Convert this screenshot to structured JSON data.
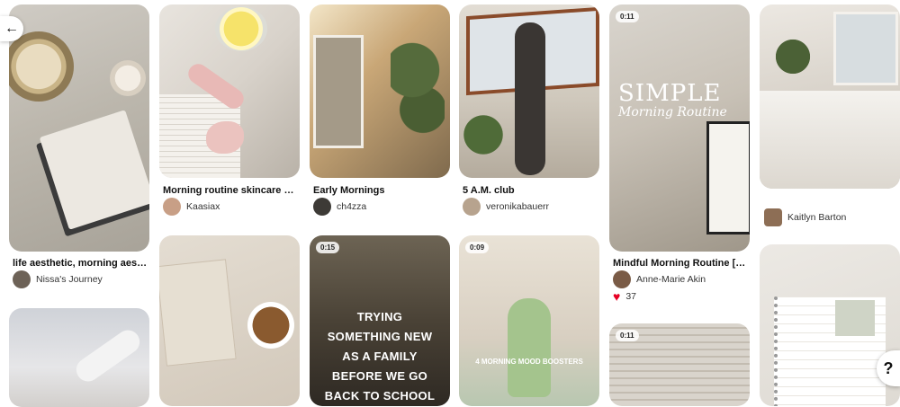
{
  "nav": {
    "back_icon": "←",
    "help_icon": "?"
  },
  "pins": [
    {
      "title": "life aesthetic, morning aesthetic",
      "author": "Nissa's Journey"
    },
    {
      "title": "Morning routine skincare mornin...",
      "author": "Kaasiax"
    },
    {
      "title": "Early Mornings",
      "author": "ch4zza"
    },
    {
      "title": "5 A.M. club",
      "author": "veronikabauerr"
    },
    {
      "title": "Mindful Morning Routine [That...",
      "author": "Anne-Marie Akin",
      "reactions": "37",
      "badge": "0:11",
      "overlay_line1": "SIMPLE",
      "overlay_line2": "Morning Routine"
    },
    {
      "author": "Kaitlyn Barton"
    },
    {
      "badge": "0:15",
      "overlay_text": "TRYING SOMETHING NEW AS A FAMILY BEFORE WE GO BACK TO SCHOOL"
    },
    {
      "badge": "0:09",
      "overlay_line1": "4 MORNING MOOD BOOSTERS"
    },
    {
      "badge": "0:11"
    }
  ],
  "colors": {
    "accent_red": "#e60023"
  }
}
